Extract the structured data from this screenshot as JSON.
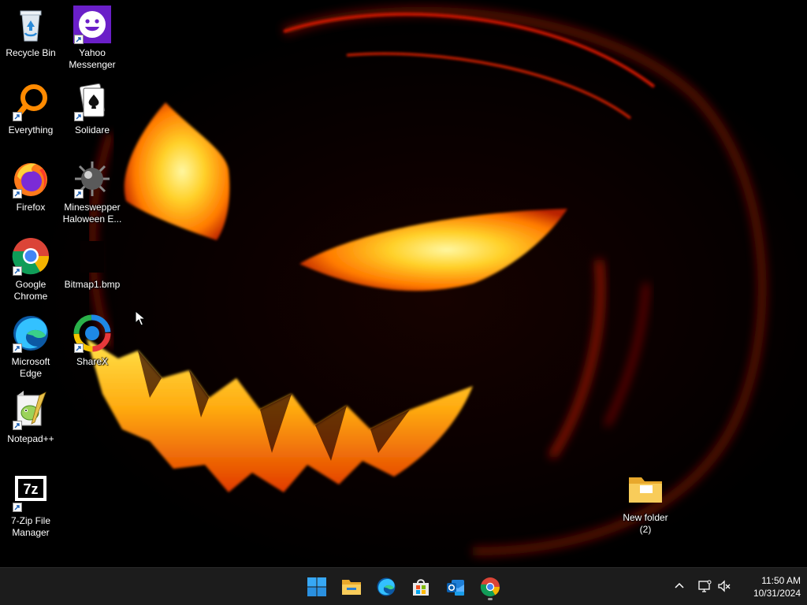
{
  "desktop": {
    "icons": [
      {
        "id": "recycle-bin",
        "label": "Recycle Bin",
        "shortcut": false
      },
      {
        "id": "yahoo-messenger",
        "label": "Yahoo\nMessenger",
        "shortcut": true
      },
      {
        "id": "everything",
        "label": "Everything",
        "shortcut": true
      },
      {
        "id": "solidare",
        "label": "Solidare",
        "shortcut": true
      },
      {
        "id": "firefox",
        "label": "Firefox",
        "shortcut": true
      },
      {
        "id": "minesweeper",
        "label": "Mineswepper\nHaloween E...",
        "shortcut": true
      },
      {
        "id": "google-chrome",
        "label": "Google\nChrome",
        "shortcut": true
      },
      {
        "id": "bitmap1",
        "label": "Bitmap1.bmp",
        "shortcut": false
      },
      {
        "id": "microsoft-edge",
        "label": "Microsoft\nEdge",
        "shortcut": true
      },
      {
        "id": "sharex",
        "label": "ShareX",
        "shortcut": true
      },
      {
        "id": "notepadpp",
        "label": "Notepad++",
        "shortcut": true
      },
      {
        "id": "7zip",
        "label": "7-Zip File\nManager",
        "shortcut": true
      },
      {
        "id": "new-folder",
        "label": "New folder\n(2)",
        "shortcut": false
      }
    ]
  },
  "taskbar": {
    "apps": [
      {
        "id": "start",
        "icon": "windows-start-icon"
      },
      {
        "id": "file-explorer",
        "icon": "file-explorer-icon"
      },
      {
        "id": "edge",
        "icon": "edge-icon"
      },
      {
        "id": "store",
        "icon": "microsoft-store-icon"
      },
      {
        "id": "outlook",
        "icon": "outlook-new-icon"
      },
      {
        "id": "chrome",
        "icon": "chrome-icon",
        "running": true
      }
    ],
    "tray": {
      "icons": [
        "chevron-up-icon",
        "network-icon",
        "speaker-muted-icon"
      ]
    },
    "clock": {
      "time": "11:50 AM",
      "date": "10/31/2024"
    }
  },
  "colors": {
    "taskbar_bg": "#1c1c1c",
    "label_text": "#ffffff",
    "pumpkin_glow": "#ffb400",
    "pumpkin_deep": "#c81a00"
  }
}
